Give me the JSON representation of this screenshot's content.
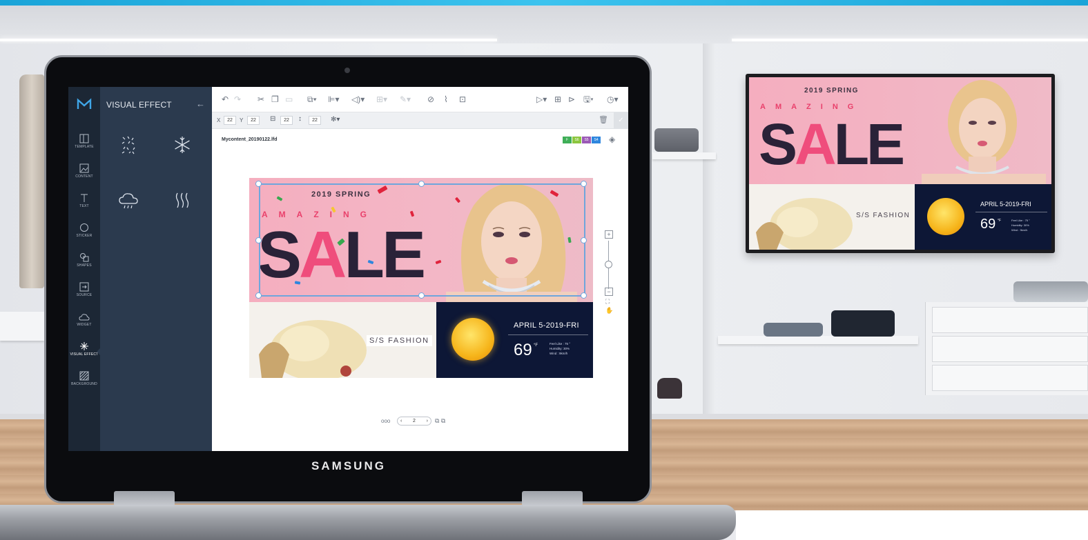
{
  "laptop": {
    "brand": "SAMSUNG"
  },
  "sidebar": {
    "items": [
      {
        "label": "TEMPLATE",
        "icon": "template-icon"
      },
      {
        "label": "CONTENT",
        "icon": "image-icon"
      },
      {
        "label": "TEXT",
        "icon": "text-icon"
      },
      {
        "label": "STICKER",
        "icon": "sticker-icon"
      },
      {
        "label": "SHAPES",
        "icon": "shapes-icon"
      },
      {
        "label": "SOURCE",
        "icon": "source-icon"
      },
      {
        "label": "WIDGET",
        "icon": "weather-widget-icon"
      },
      {
        "label": "VISUAL EFFECT",
        "icon": "sparkle-icon",
        "active": true
      },
      {
        "label": "BACKGROUND",
        "icon": "background-pattern-icon"
      }
    ]
  },
  "panel": {
    "title": "VISUAL EFFECT",
    "back_glyph": "←",
    "effects": [
      {
        "icon": "confetti-effect-icon",
        "glyph": "⁘"
      },
      {
        "icon": "snow-effect-icon",
        "glyph": "✻"
      },
      {
        "icon": "rain-effect-icon",
        "glyph": "☁"
      },
      {
        "icon": "heat-wave-effect-icon",
        "glyph": "∫∫∫"
      }
    ]
  },
  "toolbar": {
    "undo": "↶",
    "redo": "↷",
    "cut": "✂",
    "copy": "❐",
    "paste": "▭",
    "crop": "⧉▾",
    "align": "⊫▾",
    "audio": "◁)▾",
    "grid": "⊞▾",
    "pen": "✎▾",
    "link": "⊘",
    "clip": "⌇",
    "frame": "⊡",
    "play": "▷▾",
    "add_page": "⊞",
    "open": "⊳",
    "save": "🖫▾",
    "timer": "◷▾"
  },
  "properties": {
    "x_label": "X",
    "x_value": "22",
    "y_label": "Y",
    "y_value": "22",
    "w_value": "22",
    "h_value": "22",
    "effect_glyph": "✻▾",
    "trash": "🗑",
    "check": "✓"
  },
  "canvas": {
    "filename": "Mycontent_20190122.lfd",
    "chips": [
      {
        "label": "F",
        "color": "#3fae57"
      },
      {
        "label": "S6",
        "color": "#8cc63f"
      },
      {
        "label": "S5",
        "color": "#9b59b6"
      },
      {
        "label": "S4",
        "color": "#2e86de"
      }
    ],
    "layers_glyph": "◈"
  },
  "design": {
    "spring": "2019 SPRING",
    "amazing": "AMAZING",
    "sale_dark_1": "S",
    "sale_pink": "A",
    "sale_dark_2": "LE",
    "fashion": "S/S FASHION",
    "weather_date": "APRIL 5-2019-FRI",
    "weather_temp": "69",
    "weather_unit": "°F",
    "weather_feel": "Feel Like : 75 °",
    "weather_humidity": "Humidity: 30%",
    "weather_wind": "Wind : 9km/h"
  },
  "zoom": {
    "plus": "+",
    "minus": "−",
    "fit": "⛶",
    "hand": "✋"
  },
  "pager": {
    "dots": "ooo",
    "current": "2",
    "prev": "‹",
    "next": "›",
    "icons": "⧉ ⧉"
  },
  "colors": {
    "rail": "#1c2735",
    "panel": "#2b3a4e",
    "selection": "#6ea6dc",
    "banner_pink": "#f5aebf",
    "weather_navy": "#0d1736"
  }
}
